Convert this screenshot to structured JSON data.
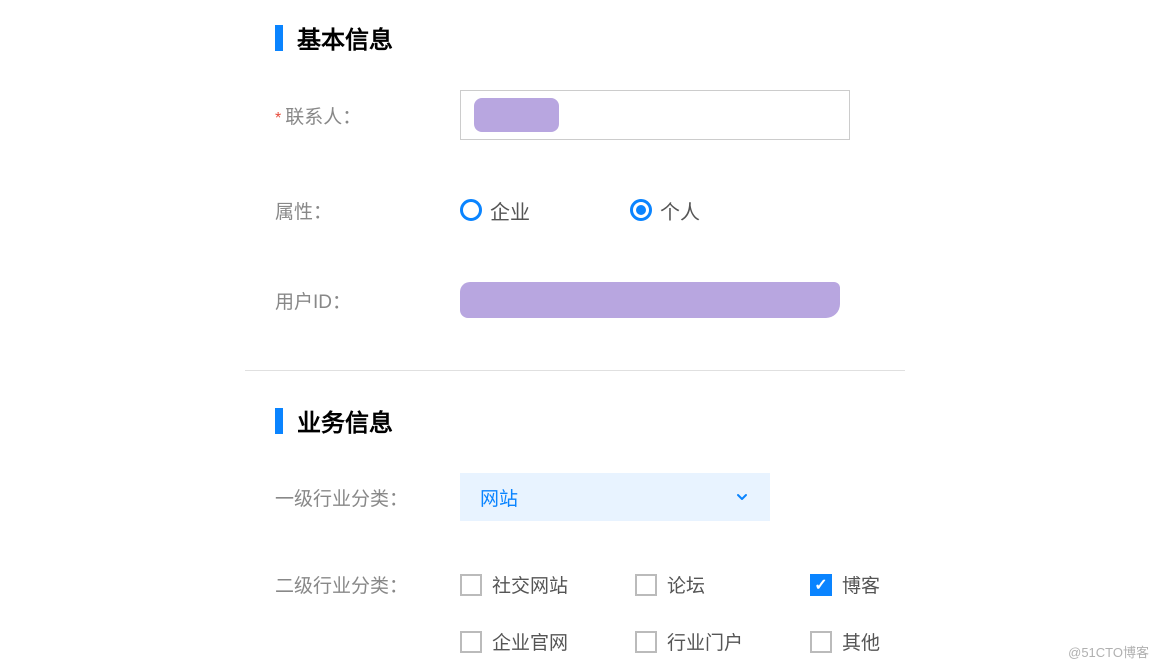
{
  "sections": {
    "basic": {
      "title": "基本信息",
      "fields": {
        "contact": {
          "label": "联系人：",
          "required": true,
          "value": ""
        },
        "attribute": {
          "label": "属性：",
          "options": {
            "enterprise": {
              "label": "企业",
              "selected": false
            },
            "personal": {
              "label": "个人",
              "selected": true
            }
          }
        },
        "user_id": {
          "label": "用户ID：",
          "value": ""
        }
      }
    },
    "business": {
      "title": "业务信息",
      "fields": {
        "industry_level_1": {
          "label": "一级行业分类：",
          "selected": "网站"
        },
        "industry_level_2": {
          "label": "二级行业分类：",
          "options": [
            {
              "label": "社交网站",
              "checked": false
            },
            {
              "label": "论坛",
              "checked": false
            },
            {
              "label": "博客",
              "checked": true
            },
            {
              "label": "企业官网",
              "checked": false
            },
            {
              "label": "行业门户",
              "checked": false
            },
            {
              "label": "其他",
              "checked": false
            }
          ]
        }
      }
    }
  },
  "watermark": "@51CTO博客"
}
